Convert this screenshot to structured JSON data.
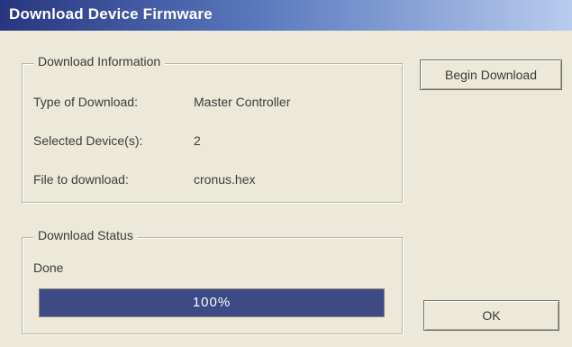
{
  "window": {
    "title": "Download Device Firmware"
  },
  "info": {
    "legend": "Download Information",
    "rows": [
      {
        "label": "Type of Download:",
        "value": "Master Controller"
      },
      {
        "label": "Selected Device(s):",
        "value": "2"
      },
      {
        "label": "File to download:",
        "value": "cronus.hex"
      }
    ]
  },
  "status": {
    "legend": "Download Status",
    "state_label": "Done",
    "progress_percent": 100,
    "progress_text": "100%"
  },
  "buttons": {
    "begin_download": "Begin Download",
    "ok": "OK"
  },
  "colors": {
    "title_bar_start": "#27357f",
    "title_bar_end": "#b8cbef",
    "progress_fill": "#3d4a86",
    "window_bg": "#ece9d8"
  }
}
